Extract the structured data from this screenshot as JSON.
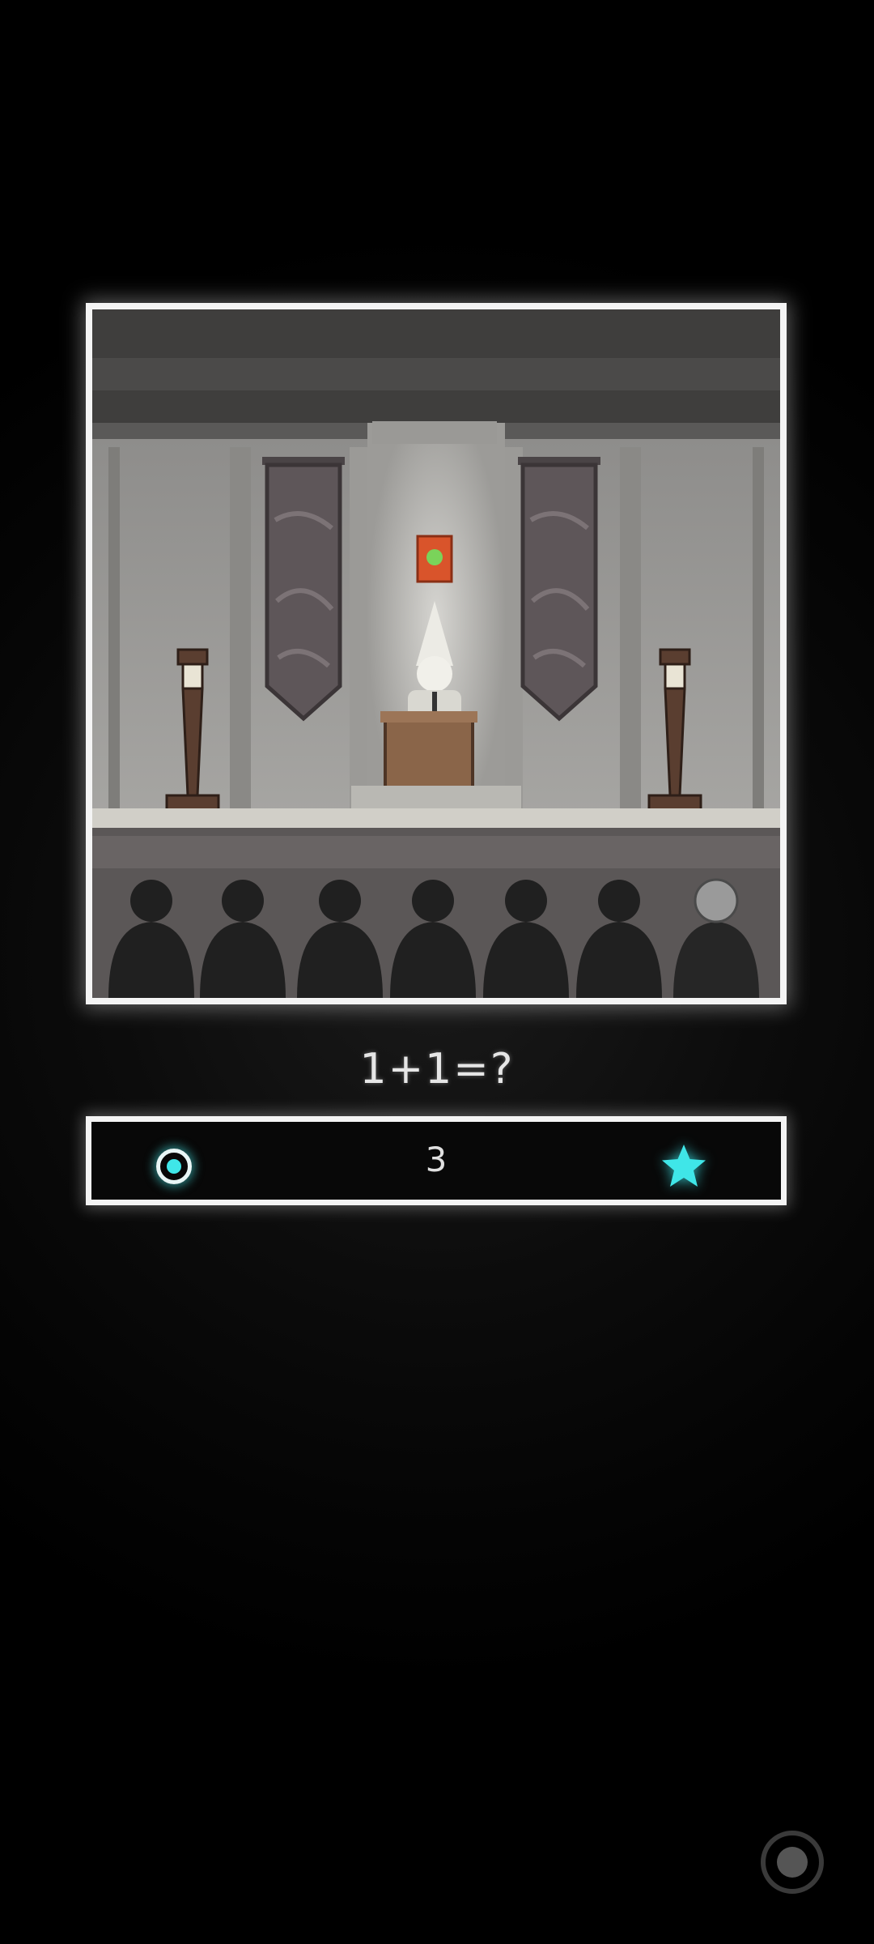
{
  "question": {
    "text": "1+1=?"
  },
  "answer": {
    "value": "3"
  },
  "icons": {
    "left": "radio-dot-icon",
    "right": "star-icon",
    "corner": "record-button-icon"
  },
  "colors": {
    "accent": "#3fe6e8",
    "frame": "#f4f4f4",
    "background": "#000000"
  }
}
